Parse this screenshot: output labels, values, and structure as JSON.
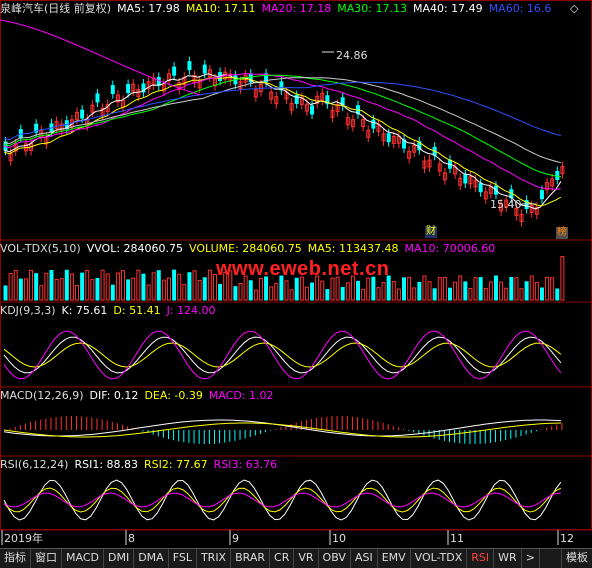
{
  "main": {
    "title": "泉峰汽车(日线 前复权)",
    "items": [
      {
        "label": "MA5: 17.98",
        "color": "#ffffff"
      },
      {
        "label": "MA10: 17.11",
        "color": "#ffff00"
      },
      {
        "label": "MA20: 17.18",
        "color": "#ff00ff"
      },
      {
        "label": "MA30: 17.13",
        "color": "#00ff00"
      },
      {
        "label": "MA40: 17.49",
        "color": "#ffffff"
      },
      {
        "label": "MA60: 16.6",
        "color": "#3050ff"
      }
    ],
    "high_label": "24.86",
    "low_label": "15.40",
    "badge_cai": "财",
    "badge_bang": "榜"
  },
  "vol": {
    "title": "VOL-TDX(5,10)",
    "items": [
      {
        "label": "VVOL: 284060.75",
        "color": "#ffffff"
      },
      {
        "label": "VOLUME: 284060.75",
        "color": "#ffff00"
      },
      {
        "label": "MA5: 113437.48",
        "color": "#ffff00"
      },
      {
        "label": "MA10: 70006.60",
        "color": "#ff00ff"
      }
    ],
    "watermark": "www.eweb.net.cn"
  },
  "kdj": {
    "title": "KDJ(9,3,3)",
    "items": [
      {
        "label": "K: 75.61",
        "color": "#ffffff"
      },
      {
        "label": "D: 51.41",
        "color": "#ffff00"
      },
      {
        "label": "J: 124.00",
        "color": "#ff00ff"
      }
    ]
  },
  "macd": {
    "title": "MACD(12,26,9)",
    "items": [
      {
        "label": "DIF: 0.12",
        "color": "#ffffff"
      },
      {
        "label": "DEA: -0.39",
        "color": "#ffff00"
      },
      {
        "label": "MACD: 1.02",
        "color": "#ff00ff"
      }
    ]
  },
  "rsi": {
    "title": "RSI(6,12,24)",
    "items": [
      {
        "label": "RSI1: 88.83",
        "color": "#ffffff"
      },
      {
        "label": "RSI2: 77.67",
        "color": "#ffff00"
      },
      {
        "label": "RSI3: 63.76",
        "color": "#ff00ff"
      }
    ]
  },
  "x_axis": [
    "2019年",
    "8",
    "9",
    "10",
    "11",
    "12"
  ],
  "tabs": [
    "指标",
    "窗口",
    "MACD",
    "DMI",
    "DMA",
    "FSL",
    "TRIX",
    "BRAR",
    "CR",
    "VR",
    "OBV",
    "ASI",
    "EMV",
    "VOL-TDX",
    "RSI",
    "WR",
    ">",
    "模板"
  ],
  "colors": {
    "up": "#ff3030",
    "down": "#00ffff",
    "bg": "#000000",
    "grid": "#8b0000"
  }
}
